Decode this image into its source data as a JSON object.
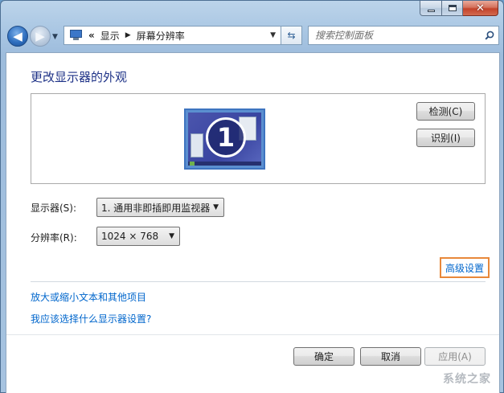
{
  "window": {
    "caption_buttons": {
      "minimize_icon": "minimize-icon",
      "maximize_icon": "maximize-icon",
      "close_icon": "close-icon"
    }
  },
  "nav": {
    "address": {
      "chevron": "«",
      "segments": [
        "显示",
        "屏幕分辨率"
      ]
    },
    "search": {
      "placeholder": "搜索控制面板"
    }
  },
  "main": {
    "title": "更改显示器的外观",
    "monitor_number": "1",
    "detect_label": "检测(C)",
    "identify_label": "识别(I)",
    "display_label": "显示器(S):",
    "display_value": "1. 通用非即插即用监视器",
    "resolution_label": "分辨率(R):",
    "resolution_value": "1024 × 768",
    "advanced_label": "高级设置",
    "links": [
      "放大或缩小文本和其他项目",
      "我应该选择什么显示器设置?"
    ]
  },
  "footer": {
    "ok_label": "确定",
    "cancel_label": "取消",
    "apply_label": "应用(A)"
  },
  "watermark": "系统之家",
  "colors": {
    "link": "#0066cc",
    "title": "#1e3287",
    "highlight_border": "#e8883a"
  }
}
